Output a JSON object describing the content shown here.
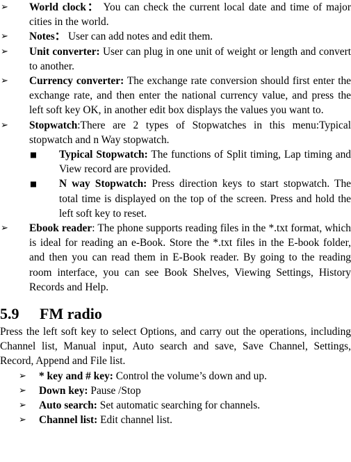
{
  "page": {
    "bullet_arrow": "➢",
    "bullet_square": "■"
  },
  "features_list": [
    {
      "term": "World clock：",
      "desc": "  You can check the current local date and time of major cities in the world."
    },
    {
      "term": "Notes：",
      "desc": "  User can add notes and edit them."
    },
    {
      "term": "Unit converter:",
      "desc": " User can plug in one unit of weight or length and convert to another."
    },
    {
      "term": "Currency converter:",
      "desc": " The exchange rate conversion should first enter the exchange rate, and then enter the national currency value, and press the left soft key OK, in another edit box displays the values you want to."
    },
    {
      "term": "Stopwatch",
      "desc": ":There are 2 types of Stopwatches in this menu:Typical stopwatch and n Way stopwatch."
    }
  ],
  "stopwatch_sublist": [
    {
      "term": "Typical Stopwatch:",
      "desc": " The functions of Split timing, Lap timing and View record are provided."
    },
    {
      "term": "N way Stopwatch:",
      "desc": " Press direction keys to start stopwatch. The total time is displayed on the top of the screen. Press and hold the left soft key to reset."
    }
  ],
  "ebook_item": {
    "term": "Ebook reader",
    "desc": ": The phone supports reading files in the *.txt format, which is ideal for reading an e-Book. Store the *.txt files in the E-book folder, and then you can read them in E-Book reader. By going to the reading room interface, you can see Book Shelves, Viewing Settings, History Records and Help."
  },
  "fm_radio_section": {
    "number": "5.9",
    "title": "FM radio",
    "intro": "Press the left soft key to select Options, and carry out the operations, including Channel list, Manual input, Auto search and save, Save Channel, Settings, Record, Append and File list.",
    "keys_list": [
      {
        "term": "* key and # key:",
        "desc": " Control the volume’s down and up."
      },
      {
        "term": "Down key:",
        "desc": " Pause /Stop"
      },
      {
        "term": "Auto search:",
        "desc": " Set automatic searching for channels."
      },
      {
        "term": "Channel list:",
        "desc": " Edit channel list."
      }
    ]
  }
}
